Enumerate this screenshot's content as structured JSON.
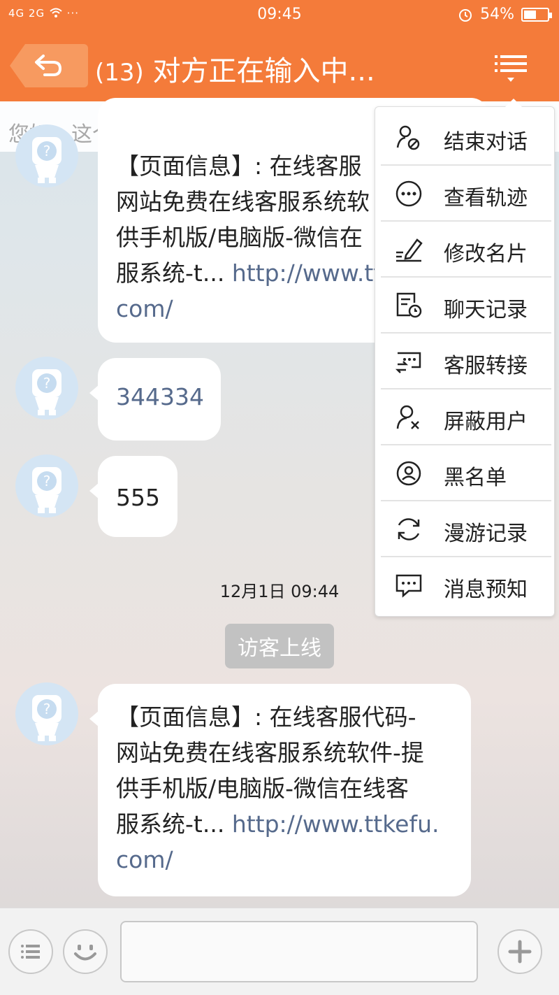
{
  "status_bar": {
    "signal": "4G 2G",
    "dots": "···",
    "time": "09:45",
    "battery": "54%",
    "battery_level": 0.54
  },
  "header": {
    "count": "(13)",
    "title": "对方正在输入中..."
  },
  "notice": {
    "text": "您好，这个软件免费吗?我rhf"
  },
  "messages": [
    {
      "lines": [
        "【页面信息】: 在线客服",
        "网站免费在线客服系统软",
        "供手机版/电脑版-微信在",
        "服系统-t... "
      ],
      "link": "http://www.ttk",
      "link_cont": "com/"
    },
    {
      "text": "344334"
    },
    {
      "text": "555"
    },
    {
      "lines": [
        "【页面信息】: 在线客服代码-",
        "网站免费在线客服系统软件-提",
        "供手机版/电脑版-微信在线客",
        "服系统-t... "
      ],
      "link": "http://www.ttkefu.",
      "link_cont": "com/"
    }
  ],
  "timestamp": "12月1日 09:44",
  "system_message": "访客上线",
  "menu": [
    {
      "label": "结束对话",
      "icon": "end-chat-icon"
    },
    {
      "label": "查看轨迹",
      "icon": "track-icon"
    },
    {
      "label": "修改名片",
      "icon": "edit-card-icon"
    },
    {
      "label": "聊天记录",
      "icon": "chat-history-icon"
    },
    {
      "label": "客服转接",
      "icon": "transfer-icon"
    },
    {
      "label": "屏蔽用户",
      "icon": "block-user-icon"
    },
    {
      "label": "黑名单",
      "icon": "blacklist-icon"
    },
    {
      "label": "漫游记录",
      "icon": "roaming-icon"
    },
    {
      "label": "消息预知",
      "icon": "message-preview-icon"
    }
  ],
  "input": {
    "value": ""
  },
  "colors": {
    "brand": "#f47b3a",
    "link": "#566a8c"
  }
}
